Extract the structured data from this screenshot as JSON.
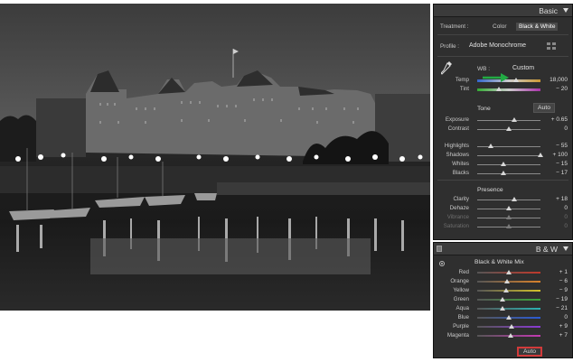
{
  "basic": {
    "title": "Basic",
    "treatment_label": "Treatment :",
    "treatment_color": "Color",
    "treatment_bw": "Black & White",
    "profile_label": "Profile :",
    "profile_value": "Adobe Monochrome",
    "wb_label": "WB :",
    "wb_value": "Custom",
    "temp": {
      "name": "Temp",
      "value": "18,000",
      "level": 0.62
    },
    "tint": {
      "name": "Tint",
      "value": "− 20",
      "level": 0.34
    },
    "tone_title": "Tone",
    "auto_label": "Auto",
    "tone": [
      {
        "name": "Exposure",
        "value": "+ 0.65",
        "level": 0.58
      },
      {
        "name": "Contrast",
        "value": "0",
        "level": 0.5
      },
      {
        "name": "Highlights",
        "value": "− 55",
        "level": 0.22
      },
      {
        "name": "Shadows",
        "value": "+ 100",
        "level": 1.0
      },
      {
        "name": "Whites",
        "value": "− 15",
        "level": 0.42
      },
      {
        "name": "Blacks",
        "value": "− 17",
        "level": 0.41
      }
    ],
    "presence_title": "Presence",
    "presence": [
      {
        "name": "Clarity",
        "value": "+ 18",
        "level": 0.59,
        "dim": false
      },
      {
        "name": "Dehaze",
        "value": "0",
        "level": 0.5,
        "dim": false
      },
      {
        "name": "Vibrance",
        "value": "0",
        "level": 0.5,
        "dim": true
      },
      {
        "name": "Saturation",
        "value": "0",
        "level": 0.5,
        "dim": true
      }
    ]
  },
  "bw": {
    "title": "B & W",
    "mix_title": "Black & White Mix",
    "auto_label": "Auto",
    "channels": [
      {
        "name": "Red",
        "value": "+ 1",
        "level": 0.505,
        "color": "#c0392b"
      },
      {
        "name": "Orange",
        "value": "− 6",
        "level": 0.47,
        "color": "#d9822b"
      },
      {
        "name": "Yellow",
        "value": "− 9",
        "level": 0.455,
        "color": "#d4c22b"
      },
      {
        "name": "Green",
        "value": "− 19",
        "level": 0.405,
        "color": "#3aa63a"
      },
      {
        "name": "Aqua",
        "value": "− 21",
        "level": 0.395,
        "color": "#2bb3b3"
      },
      {
        "name": "Blue",
        "value": "0",
        "level": 0.5,
        "color": "#2b5bd4"
      },
      {
        "name": "Purple",
        "value": "+ 9",
        "level": 0.545,
        "color": "#8a3ad4"
      },
      {
        "name": "Magenta",
        "value": "+ 7",
        "level": 0.535,
        "color": "#c43ab3"
      }
    ]
  },
  "colors": {
    "highlight_box": "#d23a3a",
    "arrow": "#22aa44"
  }
}
